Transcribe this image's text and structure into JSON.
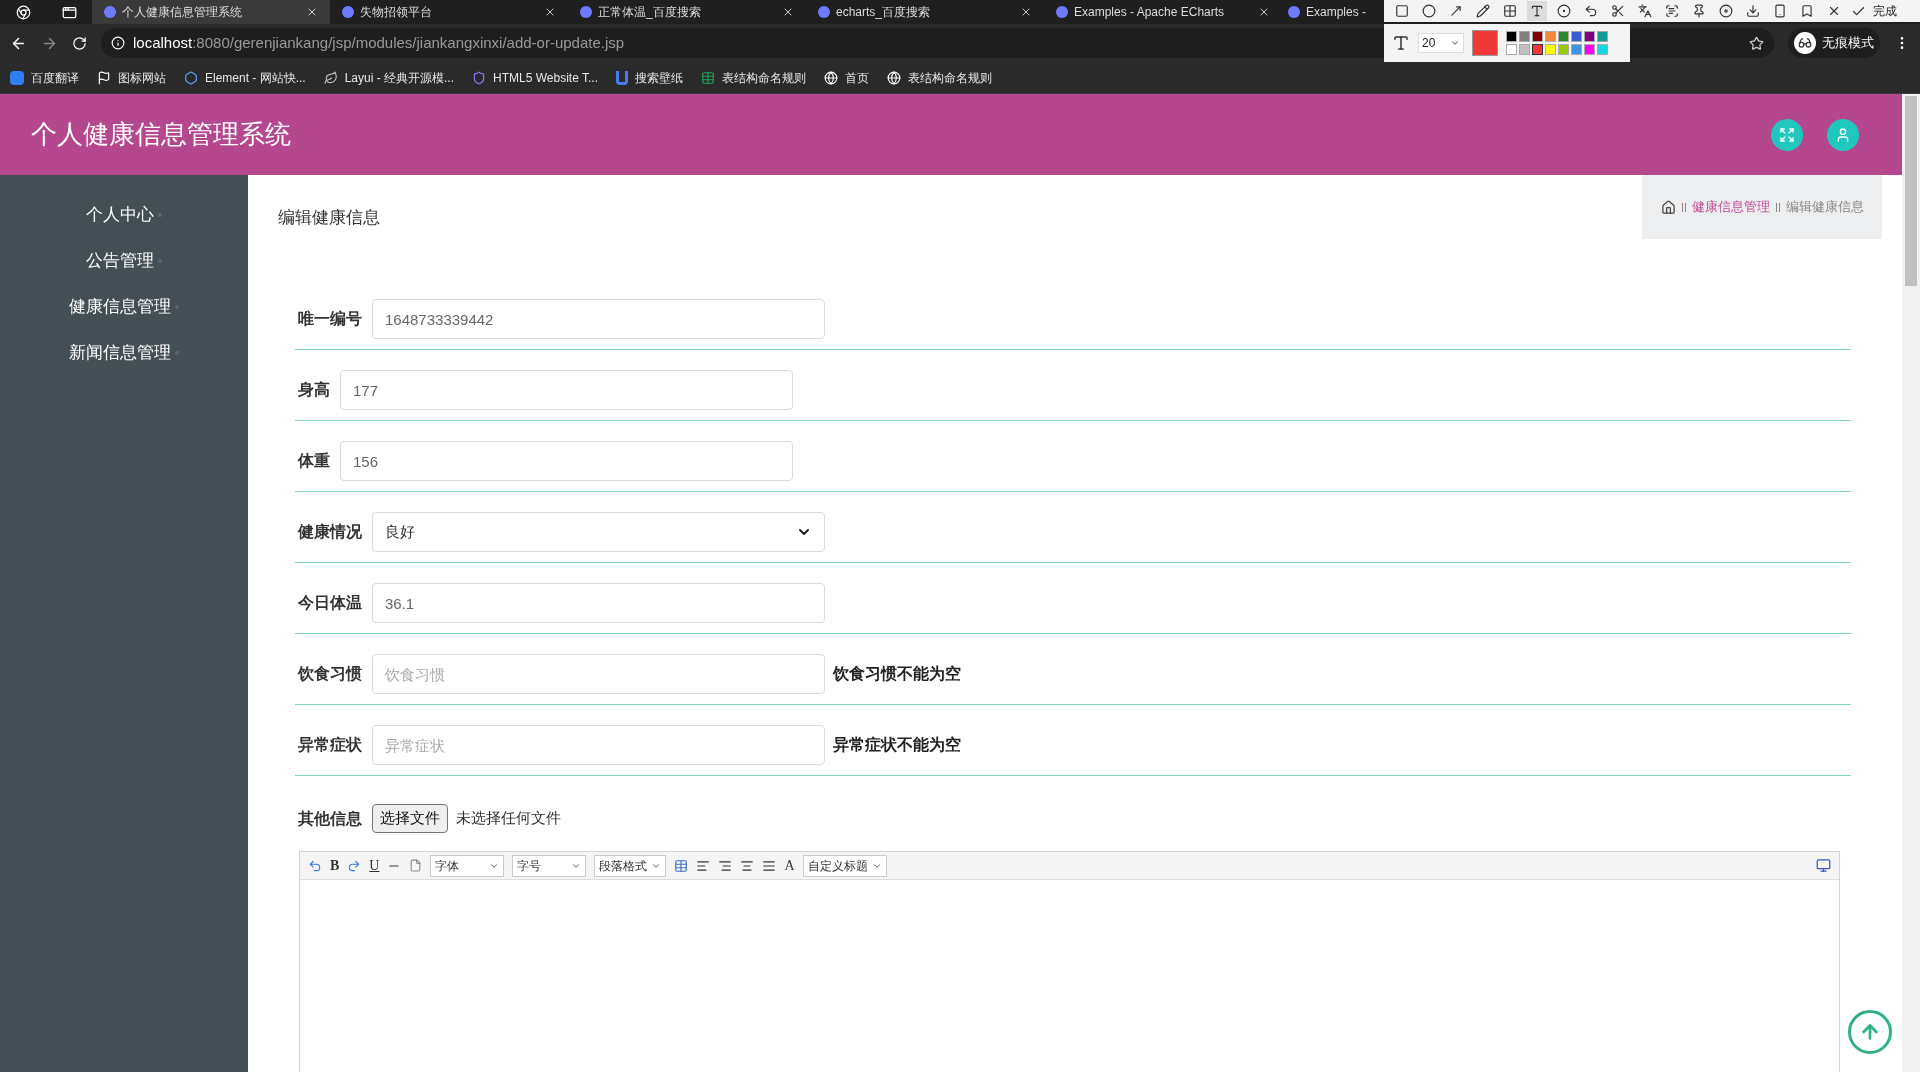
{
  "browser": {
    "tabs": [
      {
        "title": "个人健康信息管理系统",
        "selected": true
      },
      {
        "title": "失物招领平台",
        "selected": false
      },
      {
        "title": "正常体温_百度搜索",
        "selected": false
      },
      {
        "title": "echarts_百度搜索",
        "selected": false
      },
      {
        "title": "Examples - Apache ECharts",
        "selected": false
      },
      {
        "title": "Examples -",
        "selected": false
      }
    ],
    "url_host": "localhost",
    "url_path": ":8080/gerenjiankang/jsp/modules/jiankangxinxi/add-or-update.jsp",
    "profile_label": "无痕模式",
    "bookmarks": [
      {
        "kind": "translate",
        "label": "百度翻译"
      },
      {
        "kind": "flag",
        "label": "图标网站"
      },
      {
        "kind": "hex",
        "label": "Element - 网站快..."
      },
      {
        "kind": "leaf",
        "label": "Layui - 经典开源模..."
      },
      {
        "kind": "badge",
        "label": "HTML5 Website T..."
      },
      {
        "kind": "u",
        "label": "搜索壁纸"
      },
      {
        "kind": "sheet",
        "label": "表结构命名规则"
      },
      {
        "kind": "globe",
        "label": "首页"
      },
      {
        "kind": "globe",
        "label": "表结构命名规则"
      }
    ]
  },
  "capture_toolbar": {
    "tools": [
      {
        "kind": "rect",
        "selected": false
      },
      {
        "kind": "circle",
        "selected": false
      },
      {
        "kind": "arrow",
        "selected": false
      },
      {
        "kind": "pencil",
        "selected": false
      },
      {
        "kind": "mosaic",
        "selected": false
      },
      {
        "kind": "text",
        "selected": true
      },
      {
        "kind": "number",
        "selected": false
      },
      {
        "kind": "undo",
        "selected": false
      },
      {
        "kind": "cut",
        "selected": false
      },
      {
        "kind": "translate",
        "selected": false
      },
      {
        "kind": "scan",
        "selected": false
      },
      {
        "kind": "pin",
        "selected": false
      },
      {
        "kind": "record",
        "selected": false
      },
      {
        "kind": "download",
        "selected": false
      },
      {
        "kind": "phone",
        "selected": false
      },
      {
        "kind": "bookmark",
        "selected": false
      },
      {
        "kind": "close",
        "selected": false
      }
    ],
    "done_label": "完成",
    "font_size": "20",
    "palette": [
      {
        "color": "#000000",
        "selected": false
      },
      {
        "color": "#808080",
        "selected": false
      },
      {
        "color": "#800000",
        "selected": false
      },
      {
        "color": "#f08a3c",
        "selected": false
      },
      {
        "color": "#2a8a2a",
        "selected": false
      },
      {
        "color": "#3a5bd6",
        "selected": false
      },
      {
        "color": "#800080",
        "selected": false
      },
      {
        "color": "#139a94",
        "selected": false
      },
      {
        "color": "#ffffff",
        "selected": false
      },
      {
        "color": "#c0c0c0",
        "selected": false
      },
      {
        "color": "#f03a3a",
        "selected": true
      },
      {
        "color": "#ffff00",
        "selected": false
      },
      {
        "color": "#99cc00",
        "selected": false
      },
      {
        "color": "#3a95e6",
        "selected": false
      },
      {
        "color": "#ff00ff",
        "selected": false
      },
      {
        "color": "#1ad6e0",
        "selected": false
      }
    ]
  },
  "header": {
    "title": "个人健康信息管理系统"
  },
  "sidebar": {
    "items": [
      "个人中心",
      "公告管理",
      "健康信息管理",
      "新闻信息管理"
    ]
  },
  "page": {
    "title": "编辑健康信息",
    "breadcrumb": [
      "健康信息管理",
      "编辑健康信息"
    ]
  },
  "form": {
    "fields": [
      {
        "kind": "input",
        "label": "唯一编号",
        "value": "1648733339442"
      },
      {
        "kind": "input",
        "label": "身高",
        "value": "177"
      },
      {
        "kind": "input",
        "label": "体重",
        "value": "156"
      },
      {
        "kind": "select",
        "label": "健康情况",
        "value": "良好"
      },
      {
        "kind": "input",
        "label": "今日体温",
        "value": "36.1"
      },
      {
        "kind": "input",
        "label": "饮食习惯",
        "placeholder": "饮食习惯",
        "error": "饮食习惯不能为空"
      },
      {
        "kind": "input",
        "label": "异常症状",
        "placeholder": "异常症状",
        "error": "异常症状不能为空"
      },
      {
        "kind": "file",
        "label": "其他信息",
        "button": "选择文件",
        "status": "未选择任何文件"
      }
    ]
  },
  "editor": {
    "bold": "B",
    "underline": "U",
    "font_color": "A",
    "selects": [
      "字体",
      "字号",
      "段落格式",
      "自定义标题"
    ]
  }
}
